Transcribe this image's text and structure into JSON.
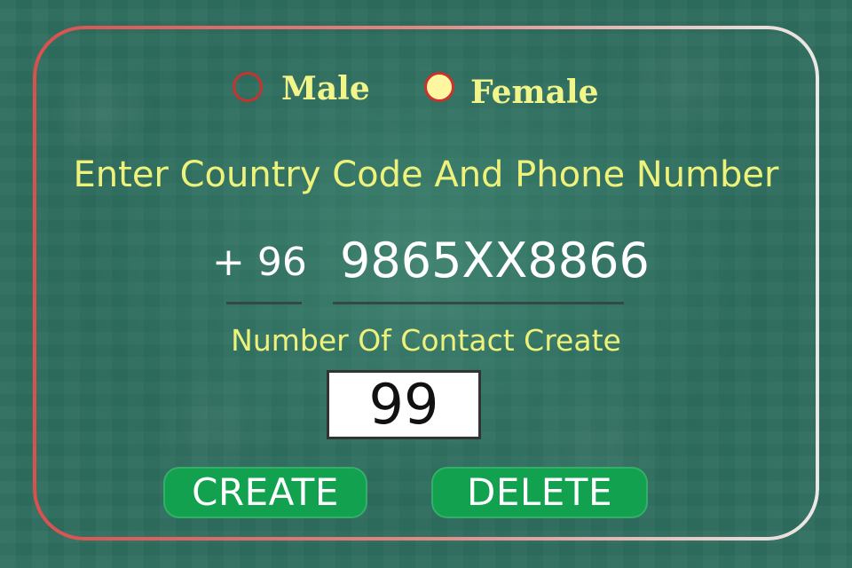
{
  "gender": {
    "male_label": "Male",
    "female_label": "Female",
    "selected": "Female"
  },
  "heading": "Enter Country Code And Phone Number",
  "phone": {
    "country_code": "+ 96",
    "number": "9865XX8866"
  },
  "contacts": {
    "label": "Number Of Contact Create",
    "count": "99"
  },
  "buttons": {
    "create": "CREATE",
    "delete": "DELETE"
  },
  "colors": {
    "background": "#2f6f60",
    "accent_text": "#eef27a",
    "button": "#11a14f",
    "radio_border": "#c8322f",
    "radio_selected": "#fff7a0"
  }
}
